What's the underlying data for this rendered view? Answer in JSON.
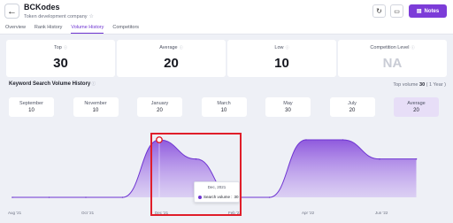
{
  "header": {
    "title": "BCKodes",
    "subtitle": "Token development company",
    "back_icon": "arrow-left-icon",
    "refresh_icon": "refresh-icon",
    "delete_icon": "trash-icon",
    "notes_label": "Notes",
    "accent": "#7c3cd8"
  },
  "tabs": [
    {
      "label": "Overview",
      "active": false
    },
    {
      "label": "Rank History",
      "active": false
    },
    {
      "label": "Volume History",
      "active": true
    },
    {
      "label": "Competitors",
      "active": false
    }
  ],
  "stats": [
    {
      "label": "Top",
      "value": "30"
    },
    {
      "label": "Average",
      "value": "20"
    },
    {
      "label": "Low",
      "value": "10"
    },
    {
      "label": "Competition Level",
      "value": "NA"
    }
  ],
  "section": {
    "title": "Keyword Search Volume History",
    "top_volume_prefix": "Top volume",
    "top_volume_value": "30",
    "top_volume_suffix": "( 1 Year )"
  },
  "months": [
    {
      "name": "September",
      "value": "10"
    },
    {
      "name": "November",
      "value": "10"
    },
    {
      "name": "January",
      "value": "20"
    },
    {
      "name": "March",
      "value": "10"
    },
    {
      "name": "May",
      "value": "30"
    },
    {
      "name": "July",
      "value": "20"
    },
    {
      "name": "Average",
      "value": "20"
    }
  ],
  "tooltip": {
    "date": "Dec, 2021",
    "series_label": "Search volume :",
    "value": "30"
  },
  "chart_data": {
    "type": "area",
    "x": [
      "Aug '21",
      "Sep '21",
      "Oct '21",
      "Nov '21",
      "Dec '21",
      "Jan '22",
      "Feb '22",
      "Mar '22",
      "Apr '22",
      "May '22",
      "Jun '22",
      "Jul '22"
    ],
    "values": [
      0,
      0,
      0,
      0,
      30,
      20,
      0,
      0,
      30,
      30,
      20,
      20
    ],
    "xticks": [
      "Aug '21",
      "Oct '21",
      "Dec '21",
      "Feb '22",
      "Apr '22",
      "Jun '22"
    ],
    "ylim": [
      0,
      30
    ],
    "highlight_index": 4,
    "series": [
      {
        "values": [
          0,
          0,
          0,
          0,
          30,
          20,
          0,
          0,
          30,
          30,
          20,
          20
        ]
      }
    ],
    "color": "#8a52dc"
  }
}
